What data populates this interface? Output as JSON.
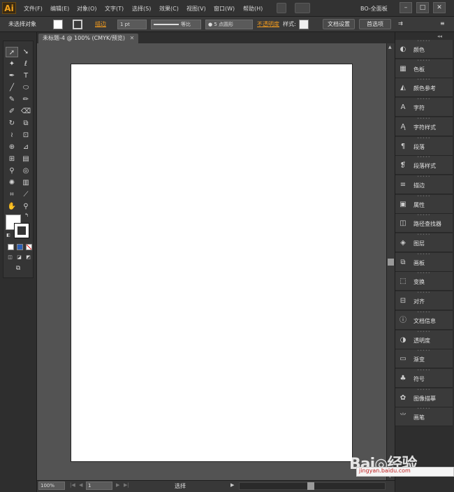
{
  "app": {
    "logo": "Ai",
    "workspace": "BO-全面板"
  },
  "menu": [
    "文件(F)",
    "编辑(E)",
    "对象(O)",
    "文字(T)",
    "选择(S)",
    "效果(C)",
    "视图(V)",
    "窗口(W)",
    "帮助(H)"
  ],
  "window_controls": {
    "minimize": "–",
    "maximize": "□",
    "close": "✕"
  },
  "control_bar": {
    "selection_status": "未选择对象",
    "stroke_label": "描边",
    "stroke_weight": "1 pt",
    "stroke_profile": "等比",
    "brush": "● 5 点圆形",
    "opacity_label": "不透明度",
    "style_label": "样式:",
    "doc_setup_button": "文档设置",
    "prefs_button": "首选项"
  },
  "document": {
    "tab_title": "未标题-4 @ 100% (CMYK/预览)"
  },
  "status_bar": {
    "zoom": "100%",
    "page": "1",
    "status_text": "选择"
  },
  "panels": [
    {
      "name": "颜色",
      "icon": "palette-icon"
    },
    {
      "name": "色板",
      "icon": "swatches-icon"
    },
    {
      "name": "颜色参考",
      "icon": "color-guide-icon"
    },
    {
      "name": "字符",
      "icon": "character-icon"
    },
    {
      "name": "字符样式",
      "icon": "character-styles-icon"
    },
    {
      "name": "段落",
      "icon": "paragraph-icon"
    },
    {
      "name": "段落样式",
      "icon": "paragraph-styles-icon"
    },
    {
      "name": "描边",
      "icon": "stroke-icon"
    },
    {
      "name": "属性",
      "icon": "attributes-icon"
    },
    {
      "name": "路径查找器",
      "icon": "pathfinder-icon"
    },
    {
      "name": "图层",
      "icon": "layers-icon"
    },
    {
      "name": "画板",
      "icon": "artboards-icon"
    },
    {
      "name": "变换",
      "icon": "transform-icon"
    },
    {
      "name": "对齐",
      "icon": "align-icon"
    },
    {
      "name": "文档信息",
      "icon": "document-info-icon"
    },
    {
      "name": "透明度",
      "icon": "transparency-icon"
    },
    {
      "name": "渐变",
      "icon": "gradient-icon"
    },
    {
      "name": "符号",
      "icon": "symbols-icon"
    },
    {
      "name": "图像描摹",
      "icon": "image-trace-icon"
    },
    {
      "name": "画笔",
      "icon": "brushes-icon"
    }
  ],
  "watermark": {
    "text": "Bai◎经验",
    "url": "jingyan.baidu.com"
  }
}
